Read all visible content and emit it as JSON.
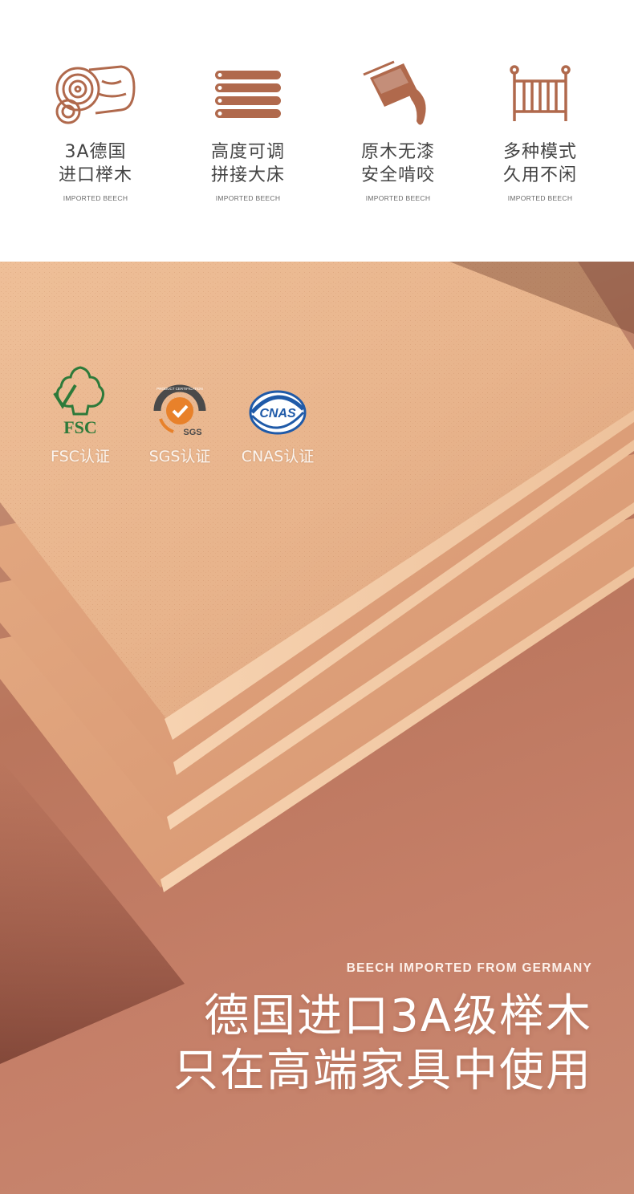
{
  "features": [
    {
      "icon": "wood-log-icon",
      "line1": "3A德国",
      "line2": "进口榉木",
      "sub": "IMPORTED BEECH"
    },
    {
      "icon": "stacked-boards-icon",
      "line1": "高度可调",
      "line2": "拼接大床",
      "sub": "IMPORTED BEECH"
    },
    {
      "icon": "paint-bucket-icon",
      "line1": "原木无漆",
      "line2": "安全啃咬",
      "sub": "IMPORTED BEECH"
    },
    {
      "icon": "crib-icon",
      "line1": "多种模式",
      "line2": "久用不闲",
      "sub": "IMPORTED BEECH"
    }
  ],
  "certifications": [
    {
      "icon": "fsc-logo",
      "logo_text": "FSC",
      "label": "FSC认证"
    },
    {
      "icon": "sgs-logo",
      "logo_text": "SGS",
      "badge_text": "PRODUCT CERTIFICATION",
      "label": "SGS认证"
    },
    {
      "icon": "cnas-logo",
      "logo_text": "CNAS",
      "label": "CNAS认证"
    }
  ],
  "caption_en": "BEECH IMPORTED FROM GERMANY",
  "headline_line1": "德国进口3A级榉木",
  "headline_line2": "只在高端家具中使用",
  "colors": {
    "icon_brown": "#b0694c",
    "text_dark": "#444444",
    "background_terracotta": "#c07a62",
    "wood": "#e7b58e",
    "fsc_green": "#2d7a3a",
    "sgs_orange": "#e8812a",
    "cnas_blue": "#1f5aa8"
  }
}
